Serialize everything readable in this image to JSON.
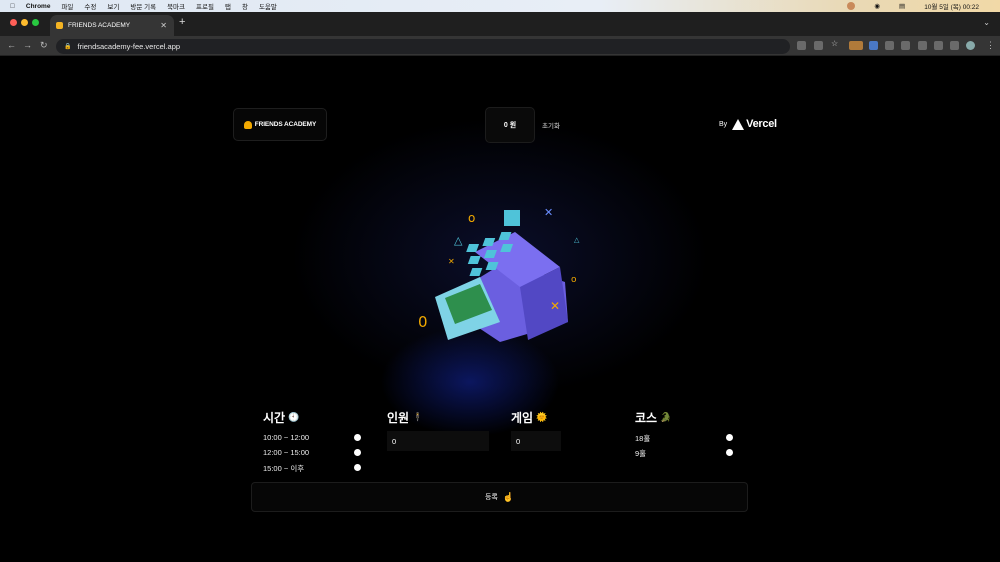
{
  "menubar": {
    "app": "Chrome",
    "items": [
      "파일",
      "수정",
      "보기",
      "방문 기록",
      "북마크",
      "프로필",
      "탭",
      "창",
      "도움말"
    ],
    "datetime": "10월 5일 (목) 00:22"
  },
  "browser": {
    "tab_title": "FRIENDS ACADEMY",
    "url": "friendsacademy-fee.vercel.app"
  },
  "header": {
    "logo_text": "FRIENDS ACADEMY",
    "total": "0 원",
    "reset_label": "초기화",
    "by_label": "By",
    "vercel_label": "Vercel"
  },
  "sections": {
    "time": {
      "title": "시간",
      "icon": "clock-icon",
      "options": [
        "10:00 ~ 12:00",
        "12:00 ~ 15:00",
        "15:00 ~ 이후"
      ]
    },
    "people": {
      "title": "인원",
      "icon": "person-icon",
      "value": "0"
    },
    "game": {
      "title": "게임",
      "icon": "sun-icon",
      "value": "0"
    },
    "course": {
      "title": "코스",
      "icon": "golf-icon",
      "options": [
        "18홀",
        "9홀"
      ]
    }
  },
  "register_label": "등록",
  "colors": {
    "background": "#000000",
    "register_cash_machine": "#6b5fe0",
    "accent_yellow": "#f2a900"
  }
}
